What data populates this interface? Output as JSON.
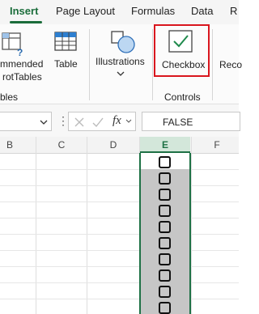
{
  "tabs": [
    {
      "label": "Insert",
      "active": true
    },
    {
      "label": "Page Layout",
      "active": false
    },
    {
      "label": "Formulas",
      "active": false
    },
    {
      "label": "Data",
      "active": false
    },
    {
      "label": "R",
      "active": false
    }
  ],
  "ribbon": {
    "recommended_pivottables": {
      "line1": "mmended",
      "line2": "rotTables"
    },
    "table": "Table",
    "illustrations": "Illustrations",
    "checkbox": "Checkbox",
    "next_cut": "Reco",
    "groups": {
      "tables": "bles",
      "controls": "Controls"
    }
  },
  "formula_bar": {
    "name_box_value": "",
    "fx": "fx",
    "formula_value": "FALSE"
  },
  "columns": [
    "B",
    "C",
    "D",
    "E",
    "F"
  ],
  "active_column": "E",
  "checkbox_rows": 10,
  "colors": {
    "accent": "#1b6d3b",
    "highlight": "#d9161e",
    "selection_fill": "#c6c6c6"
  }
}
